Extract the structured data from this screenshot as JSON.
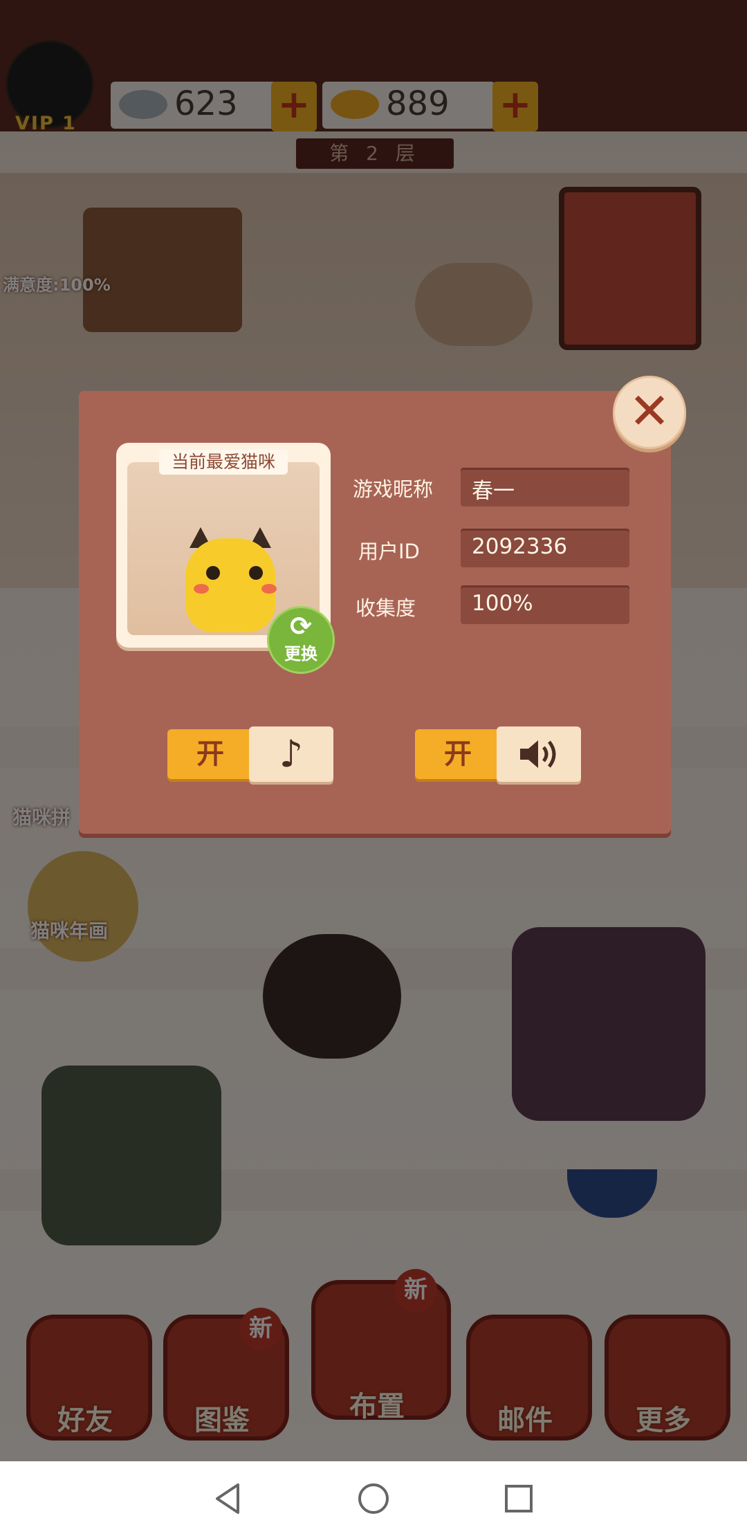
{
  "header": {
    "vip_label": "VIP 1",
    "fish_gray_count": "623",
    "fish_gold_count": "889",
    "plus_symbol": "+",
    "floor_label": "第 2 层"
  },
  "side": {
    "satisfaction": "满意度:100%",
    "activity1": "猫咪拼",
    "activity2": "猫咪年画"
  },
  "bottom_nav": [
    {
      "label": "好友"
    },
    {
      "label": "图鉴",
      "badge": "新"
    },
    {
      "label": "布置",
      "badge": "新"
    },
    {
      "label": "邮件"
    },
    {
      "label": "更多"
    }
  ],
  "dialog": {
    "card_title": "当前最爱猫咪",
    "change_label": "更换",
    "close_symbol": "✕",
    "fields": {
      "nickname_label": "游戏昵称",
      "nickname_value": "春一",
      "userid_label": "用户ID",
      "userid_value": "2092336",
      "collection_label": "收集度",
      "collection_value": "100%"
    },
    "music_toggle": {
      "state_label": "开",
      "icon": "music-note-icon"
    },
    "sound_toggle": {
      "state_label": "开",
      "icon": "speaker-icon"
    }
  },
  "colors": {
    "dialog_bg": "#a76455",
    "toggle_on": "#f5ad28",
    "change_button": "#7ab53c"
  }
}
